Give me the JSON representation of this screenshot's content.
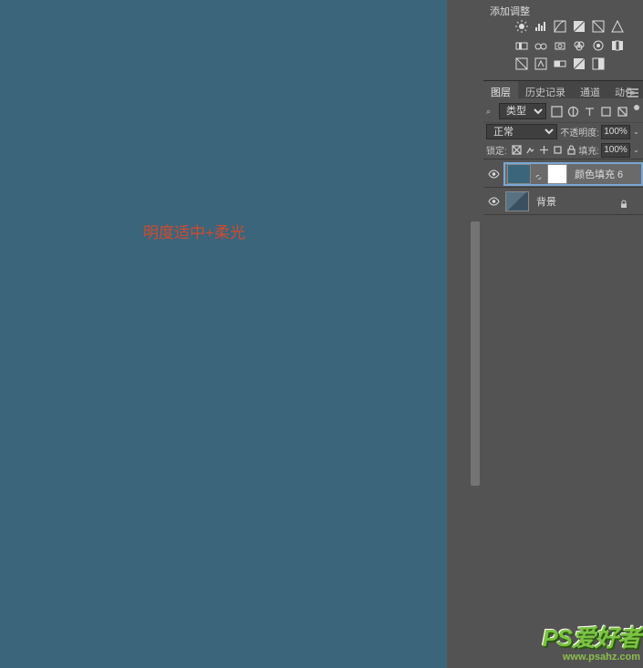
{
  "canvas": {
    "annotation": "明度适中+柔光"
  },
  "adjustments": {
    "header": "添加调整"
  },
  "tabs": {
    "layers": "图层",
    "history": "历史记录",
    "channels": "通道",
    "actions": "动作"
  },
  "filter": {
    "label": "类型"
  },
  "blend": {
    "mode": "正常",
    "opacity_label": "不透明度:",
    "opacity_value": "100%"
  },
  "lock": {
    "label": "锁定:",
    "fill_label": "填充:",
    "fill_value": "100%"
  },
  "layers": {
    "fill_layer": "颜色填充 6",
    "background": "背景"
  },
  "watermark": {
    "logo": "PS爱好者",
    "url": "www.psahz.com"
  }
}
